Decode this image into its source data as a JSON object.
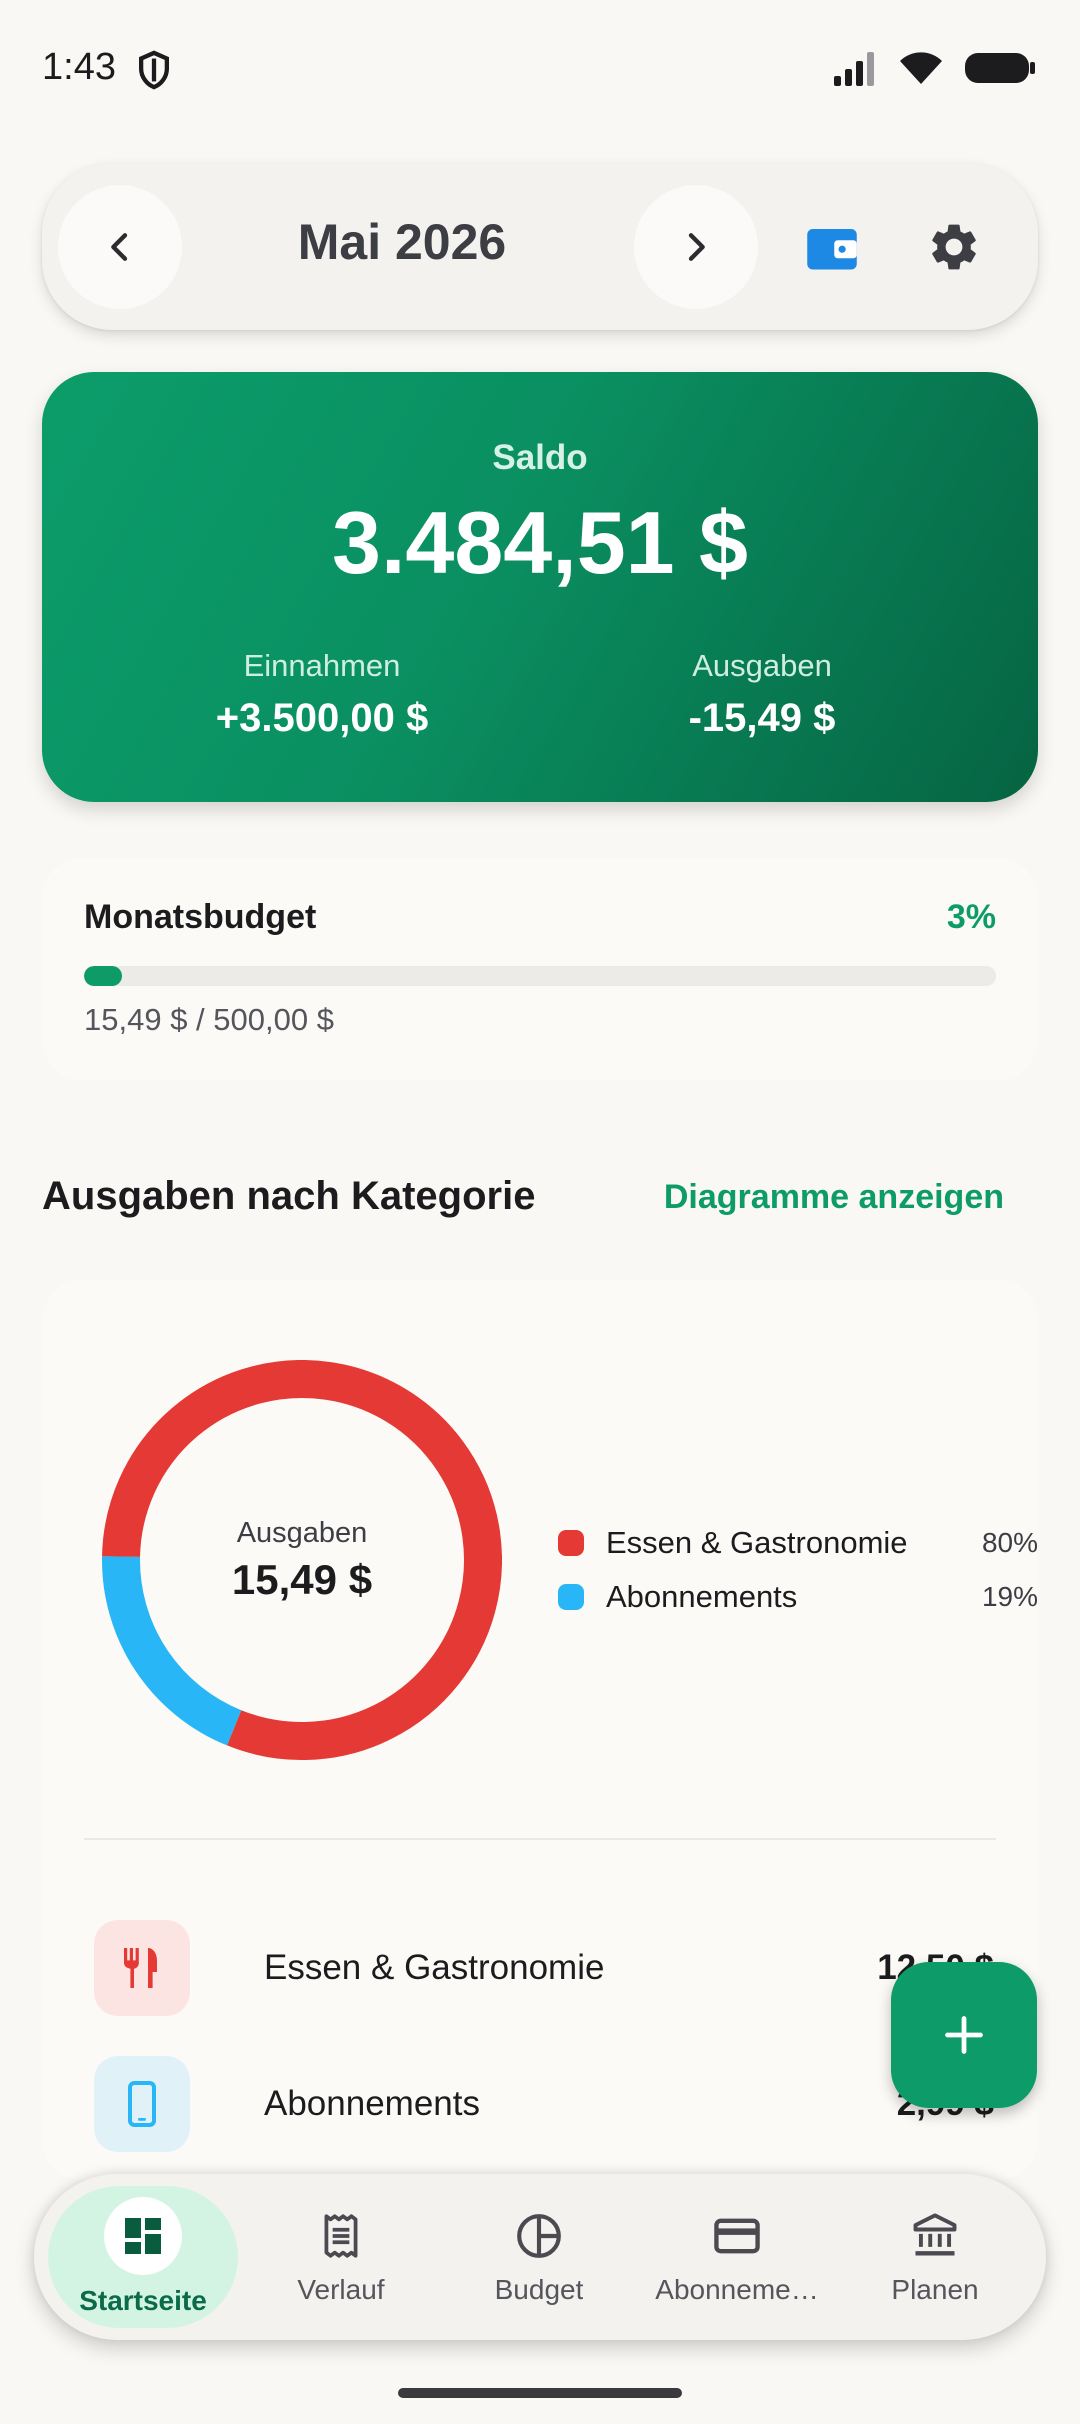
{
  "status_bar": {
    "time": "1:43"
  },
  "header": {
    "month": "Mai 2026",
    "prev_icon": "chevron-left-icon",
    "next_icon": "chevron-right-icon",
    "wallet_icon": "wallet-icon",
    "settings_icon": "gear-icon"
  },
  "balance": {
    "label": "Saldo",
    "value": "3.484,51 $",
    "income_label": "Einnahmen",
    "income_value": "+3.500,00 $",
    "expense_label": "Ausgaben",
    "expense_value": "-15,49 $"
  },
  "budget": {
    "title": "Monatsbudget",
    "percent_label": "3%",
    "progress_fraction": 0.03,
    "amount": "15,49 $ / 500,00 $"
  },
  "categories_section": {
    "title": "Ausgaben nach Kategorie",
    "link": "Diagramme anzeigen",
    "center_label": "Ausgaben",
    "center_value": "15,49 $"
  },
  "chart_data": {
    "type": "pie",
    "categories": [
      "Essen & Gastronomie",
      "Abonnements"
    ],
    "values": [
      80,
      19
    ],
    "value_labels": [
      "80%",
      "19%"
    ],
    "colors": [
      "#e53935",
      "#29b6f6"
    ]
  },
  "category_list": [
    {
      "name": "Essen & Gastronomie",
      "amount": "12,50 $",
      "icon": "fork-knife-icon",
      "color": "#e53935",
      "bg": "#fbe4e1"
    },
    {
      "name": "Abonnements",
      "amount": "2,99 $",
      "icon": "smartphone-icon",
      "color": "#29b6f6",
      "bg": "#e1f1f8"
    }
  ],
  "fab": {
    "icon": "plus-icon"
  },
  "bottom_nav": [
    {
      "label": "Startseite",
      "icon": "dashboard-icon",
      "active": true
    },
    {
      "label": "Verlauf",
      "icon": "receipt-icon",
      "active": false
    },
    {
      "label": "Budget",
      "icon": "pie-chart-icon",
      "active": false
    },
    {
      "label": "Abonneme…",
      "icon": "credit-card-icon",
      "active": false
    },
    {
      "label": "Planen",
      "icon": "bank-icon",
      "active": false
    }
  ]
}
